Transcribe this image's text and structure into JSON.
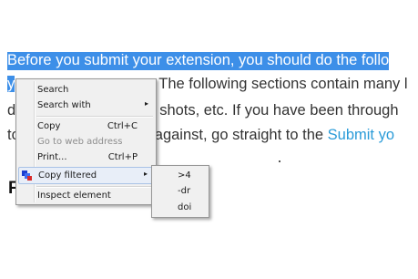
{
  "document": {
    "line1": "Before you submit your extension, you should do the follo",
    "line2_selected": "y",
    "line2_rest": "The following sections contain many l",
    "line3_start": "d",
    "line3_rest": "shots, etc. If you have been through",
    "line4_start": "to",
    "line4_mid": "against, go straight to the ",
    "line4_link": "Submit yo",
    "heading": "F"
  },
  "context_menu": {
    "search": "Search",
    "search_with": "Search with",
    "copy": "Copy",
    "copy_shortcut": "Ctrl+C",
    "go_to_web_address": "Go to web address",
    "print": "Print...",
    "print_shortcut": "Ctrl+P",
    "copy_filtered": "Copy filtered",
    "inspect_element": "Inspect element",
    "submenu_arrow": "▸"
  },
  "submenu": {
    "items": [
      ">4",
      "-dr",
      "doi"
    ]
  },
  "colors": {
    "selection": "#3d8fe8",
    "link": "#2a9bd8",
    "menu_background": "#f0f0f0"
  }
}
